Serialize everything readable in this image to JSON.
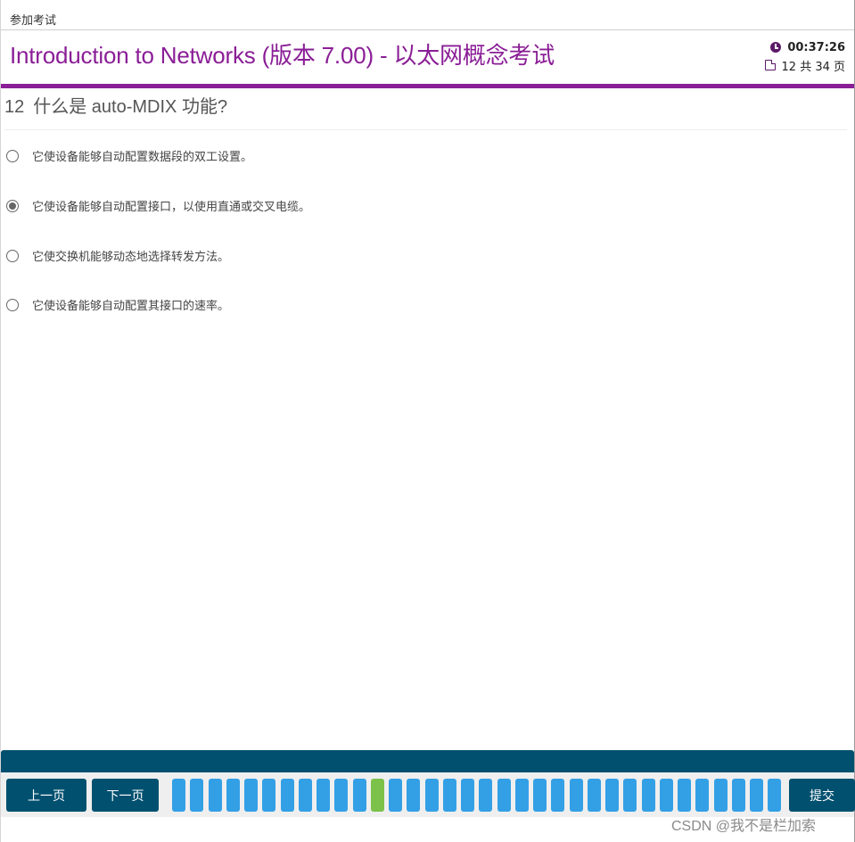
{
  "window": {
    "title": "参加考试"
  },
  "header": {
    "exam_title": "Introduction to Networks (版本 7.00) - 以太网概念考试",
    "timer": "00:37:26",
    "page_info": "12 共 34 页",
    "accent_color": "#8a1e96"
  },
  "question": {
    "number": "12",
    "text": "什么是 auto-MDIX 功能?",
    "options": [
      {
        "label": "它使设备能够自动配置数据段的双工设置。",
        "selected": false
      },
      {
        "label": "它使设备能够自动配置接口，以使用直通或交叉电缆。",
        "selected": true
      },
      {
        "label": "它使交换机能够动态地选择转发方法。",
        "selected": false
      },
      {
        "label": "它使设备能够自动配置其接口的速率。",
        "selected": false
      }
    ]
  },
  "navigation": {
    "prev_label": "上一页",
    "next_label": "下一页",
    "submit_label": "提交",
    "total_pages": 34,
    "current_page": 12,
    "page_color": "#33a0e6",
    "current_color": "#7cc14a",
    "bar_color": "#02506f"
  },
  "watermark": "CSDN @我不是栏加索"
}
